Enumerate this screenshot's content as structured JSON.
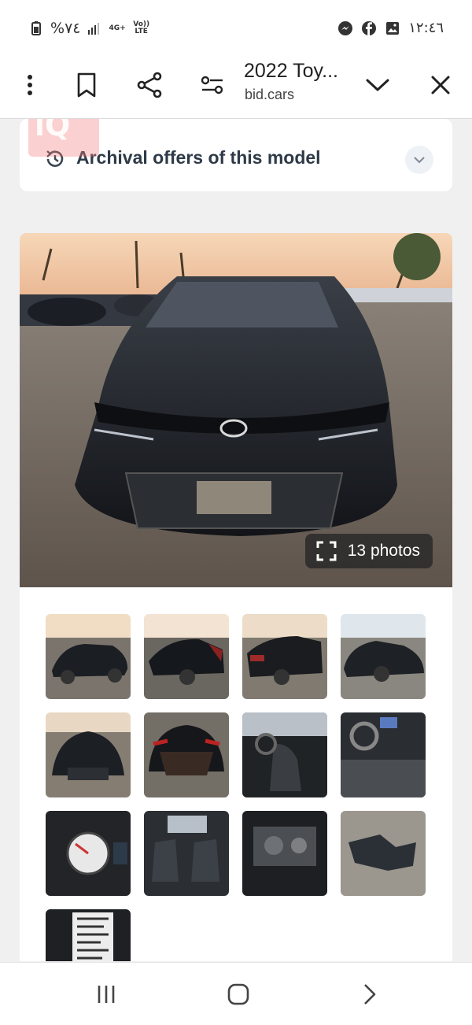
{
  "status_bar": {
    "battery": "%٧٤",
    "network_4g": "4G+",
    "network_volte": "Vo)) LTE",
    "time": "١٢:٤٦",
    "icons": [
      "battery-icon",
      "signal-icon",
      "messenger-icon",
      "facebook-icon",
      "gallery-icon"
    ]
  },
  "toolbar": {
    "title": "2022 Toy...",
    "url": "bid.cars",
    "icons": [
      "more-vertical-icon",
      "bookmark-icon",
      "share-icon",
      "tune-icon",
      "chevron-down-icon",
      "close-icon"
    ]
  },
  "watermark": {
    "text": "iQ"
  },
  "archive": {
    "label": "Archival offers of this model",
    "icon": "history-icon",
    "expand_icon": "chevron-down-icon"
  },
  "gallery": {
    "photo_count_label": "13 photos",
    "fullscreen_icon": "fullscreen-icon",
    "thumbnails": [
      "front-left-exterior",
      "rear-left-exterior",
      "rear-right-exterior",
      "front-right-exterior",
      "front-exterior",
      "rear-damage",
      "interior-front-seats",
      "dashboard-interior",
      "instrument-cluster",
      "rear-seats",
      "engine-bay",
      "damaged-parts",
      "vin-label"
    ]
  },
  "nav_bar": {
    "icons": [
      "recent-apps-icon",
      "home-icon",
      "back-icon"
    ]
  },
  "colors": {
    "page_bg": "#f0f0f1",
    "card_bg": "#ffffff",
    "archive_text": "#2e3a47",
    "overlay": "#282828"
  }
}
